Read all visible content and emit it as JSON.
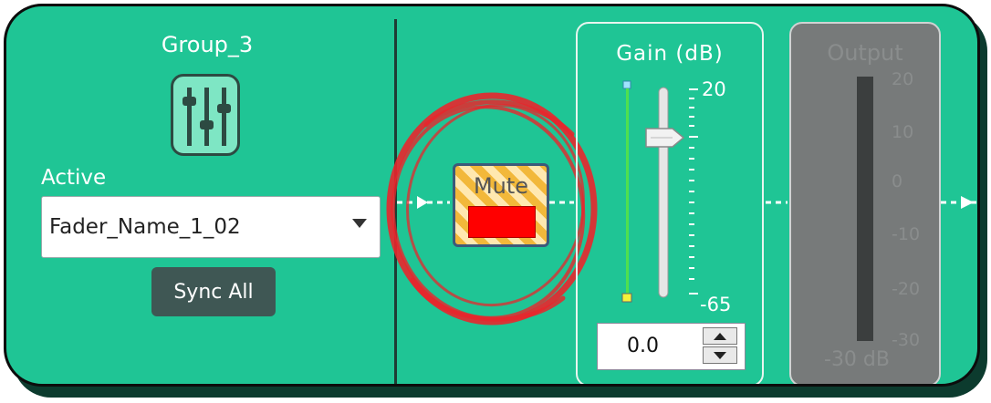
{
  "group": {
    "title": "Group_3",
    "icon": "mixer-faders-icon"
  },
  "active": {
    "label": "Active",
    "selected": "Fader_Name_1_02"
  },
  "sync_button": {
    "label": "Sync All"
  },
  "mute": {
    "label": "Mute",
    "state_color": "#ff0000"
  },
  "gain": {
    "title": "Gain  (dB)",
    "max_label": "20",
    "min_label": "-65",
    "value": "0.0"
  },
  "output": {
    "title": "Output",
    "ticks": [
      "20",
      "10",
      "0",
      "-10",
      "-20",
      "-30"
    ],
    "unit": "-30 dB"
  },
  "colors": {
    "panel": "#1fc595",
    "output_bg": "#777a7a",
    "annotation": "#e8262c"
  }
}
